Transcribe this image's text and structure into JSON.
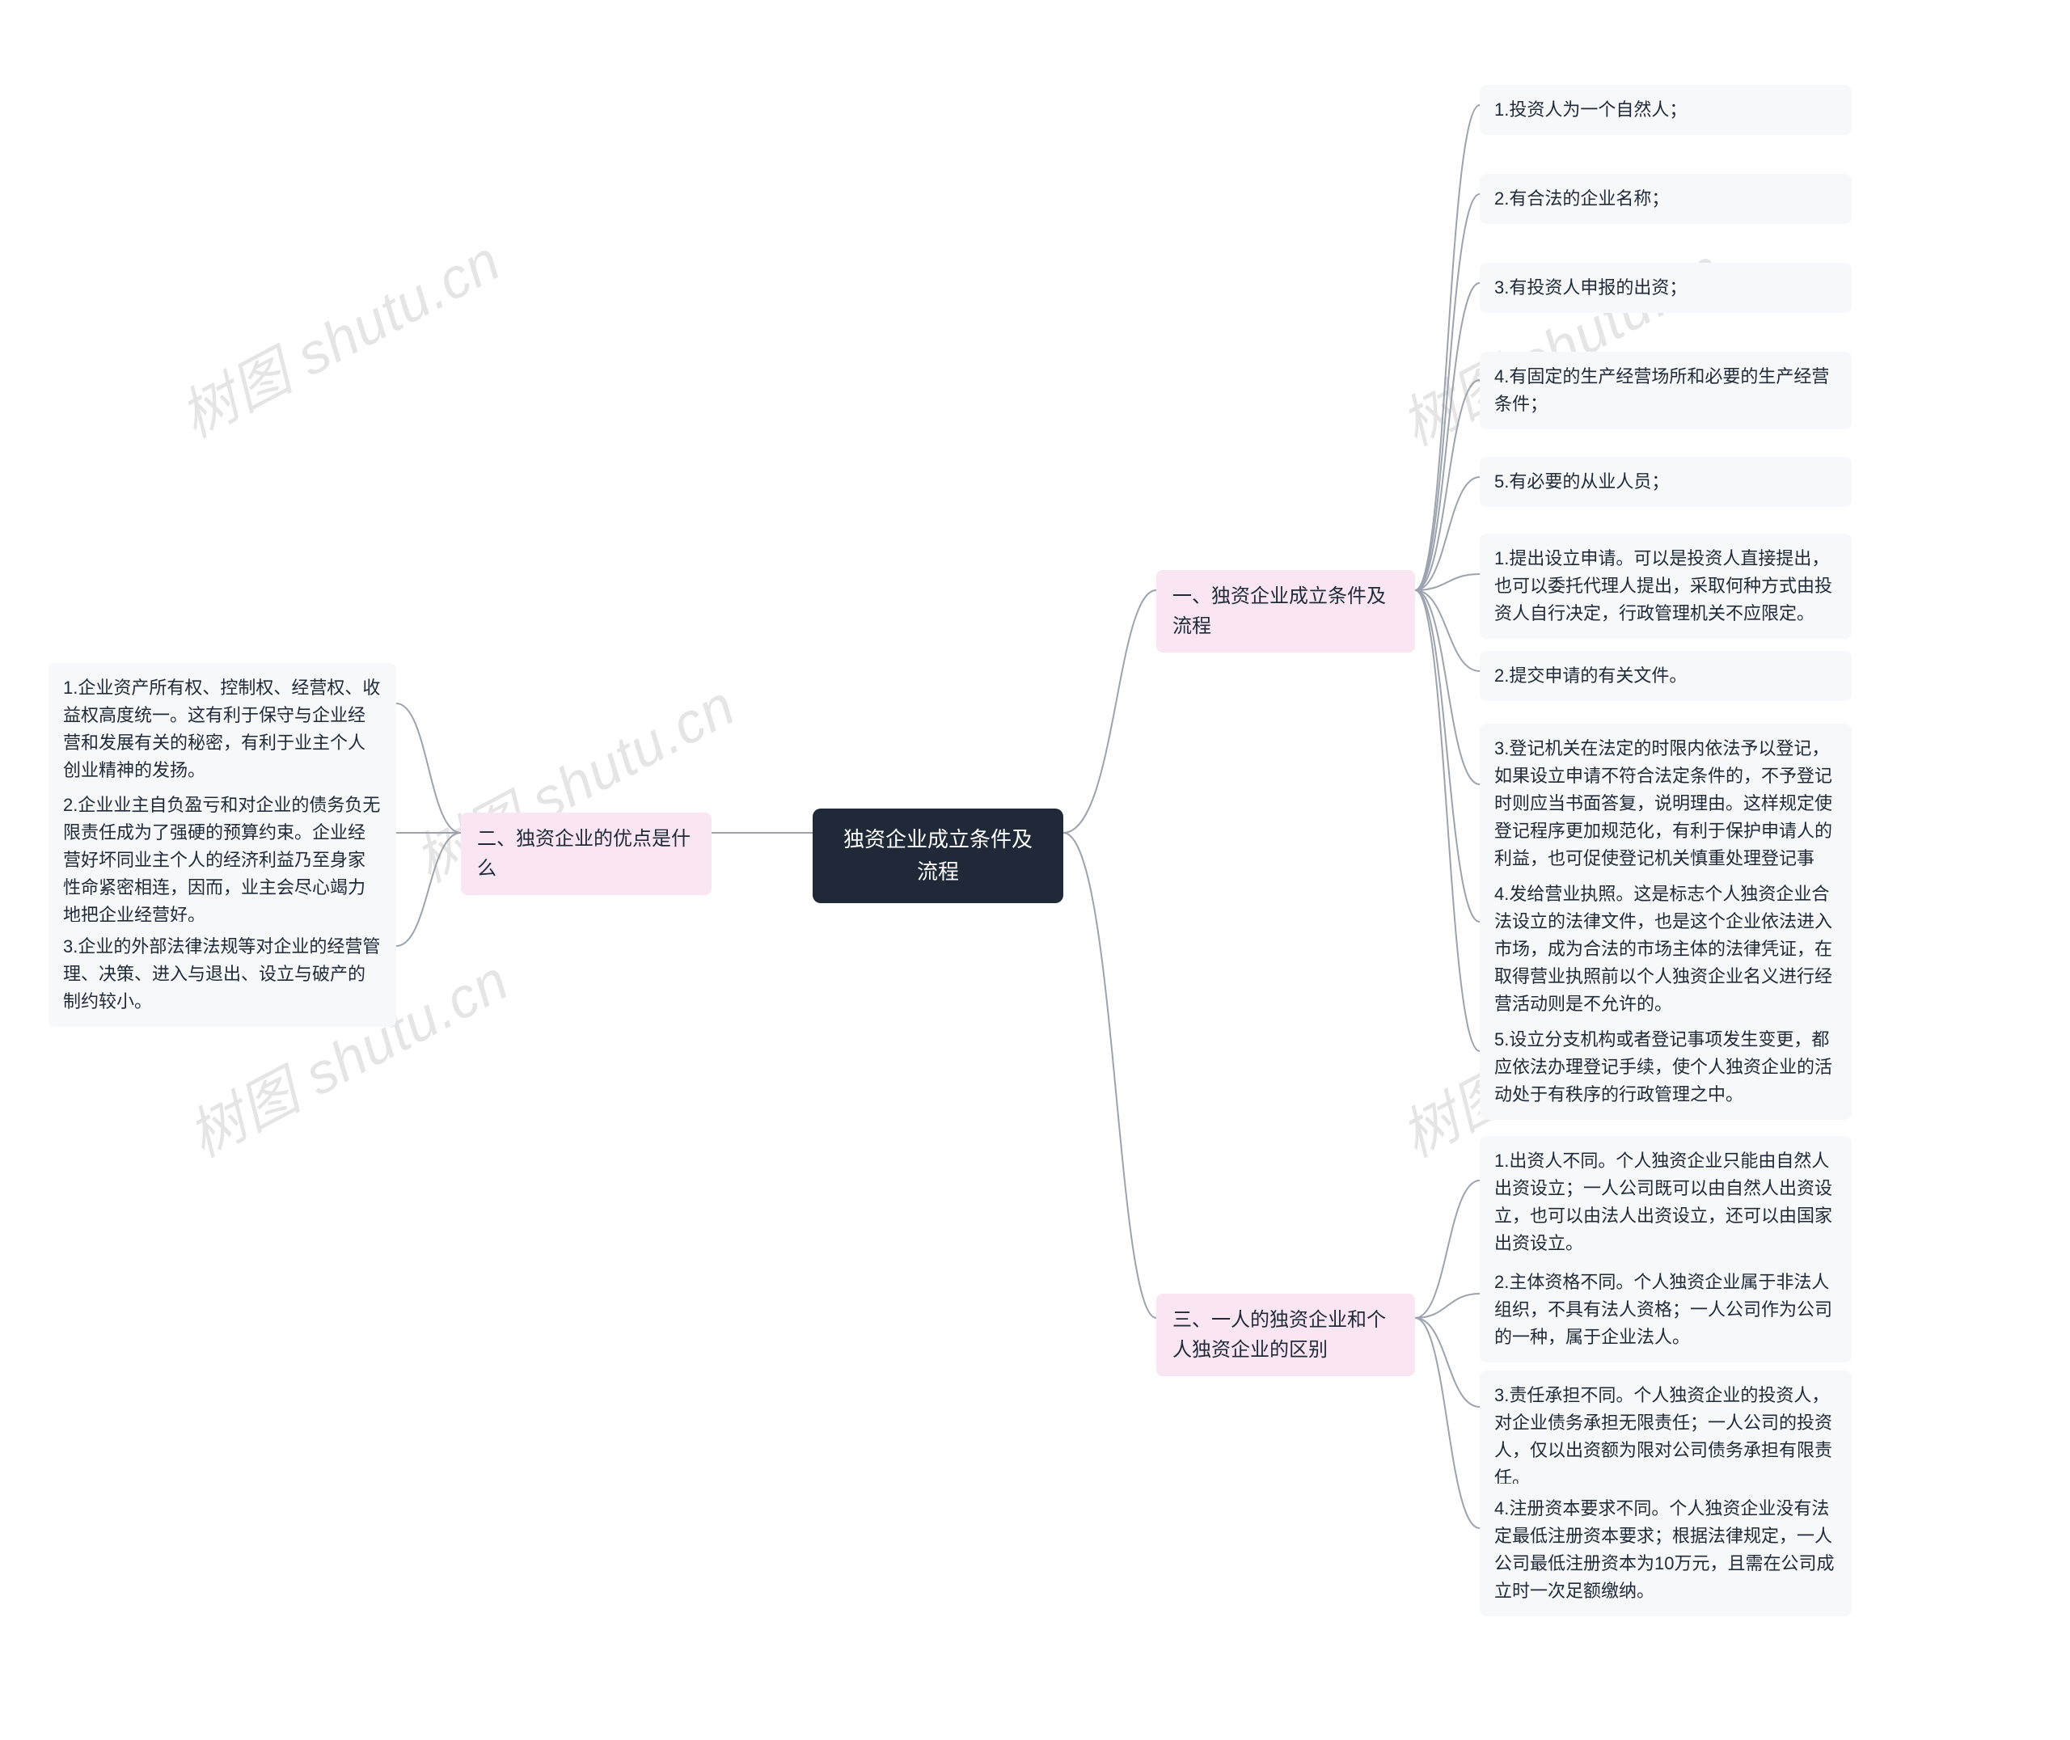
{
  "root": {
    "title": "独资企业成立条件及流程"
  },
  "branches": {
    "b1": {
      "label": "一、独资企业成立条件及流程"
    },
    "b2": {
      "label": "二、独资企业的优点是什么"
    },
    "b3": {
      "label": "三、一人的独资企业和个人独资企业的区别"
    }
  },
  "leaves": {
    "b1_1": "1.投资人为一个自然人；",
    "b1_2": "2.有合法的企业名称；",
    "b1_3": "3.有投资人申报的出资；",
    "b1_4": "4.有固定的生产经营场所和必要的生产经营条件；",
    "b1_5": "5.有必要的从业人员；",
    "b1_6": "1.提出设立申请。可以是投资人直接提出，也可以委托代理人提出，采取何种方式由投资人自行决定，行政管理机关不应限定。",
    "b1_7": "2.提交申请的有关文件。",
    "b1_8": "3.登记机关在法定的时限内依法予以登记，如果设立申请不符合法定条件的，不予登记时则应当书面答复，说明理由。这样规定使登记程序更加规范化，有利于保护申请人的利益，也可促使登记机关慎重处理登记事宜。",
    "b1_9": "4.发给营业执照。这是标志个人独资企业合法设立的法律文件，也是这个企业依法进入市场，成为合法的市场主体的法律凭证，在取得营业执照前以个人独资企业名义进行经营活动则是不允许的。",
    "b1_10": "5.设立分支机构或者登记事项发生变更，都应依法办理登记手续，使个人独资企业的活动处于有秩序的行政管理之中。",
    "b2_1": "1.企业资产所有权、控制权、经营权、收益权高度统一。这有利于保守与企业经营和发展有关的秘密，有利于业主个人创业精神的发扬。",
    "b2_2": "2.企业业主自负盈亏和对企业的债务负无限责任成为了强硬的预算约束。企业经营好坏同业主个人的经济利益乃至身家性命紧密相连，因而，业主会尽心竭力地把企业经营好。",
    "b2_3": "3.企业的外部法律法规等对企业的经营管理、决策、进入与退出、设立与破产的制约较小。",
    "b3_1": "1.出资人不同。个人独资企业只能由自然人出资设立；一人公司既可以由自然人出资设立，也可以由法人出资设立，还可以由国家出资设立。",
    "b3_2": "2.主体资格不同。个人独资企业属于非法人组织，不具有法人资格；一人公司作为公司的一种，属于企业法人。",
    "b3_3": "3.责任承担不同。个人独资企业的投资人，对企业债务承担无限责任；一人公司的投资人，仅以出资额为限对公司债务承担有限责任。",
    "b3_4": "4.注册资本要求不同。个人独资企业没有法定最低注册资本要求；根据法律规定，一人公司最低注册资本为10万元，且需在公司成立时一次足额缴纳。"
  },
  "watermark": "树图 shutu.cn",
  "chart_data": {
    "type": "mindmap",
    "root": "独资企业成立条件及流程",
    "children": [
      {
        "label": "一、独资企业成立条件及流程",
        "side": "right",
        "children": [
          "1.投资人为一个自然人；",
          "2.有合法的企业名称；",
          "3.有投资人申报的出资；",
          "4.有固定的生产经营场所和必要的生产经营条件；",
          "5.有必要的从业人员；",
          "1.提出设立申请。可以是投资人直接提出，也可以委托代理人提出，采取何种方式由投资人自行决定，行政管理机关不应限定。",
          "2.提交申请的有关文件。",
          "3.登记机关在法定的时限内依法予以登记，如果设立申请不符合法定条件的，不予登记时则应当书面答复，说明理由。这样规定使登记程序更加规范化，有利于保护申请人的利益，也可促使登记机关慎重处理登记事宜。",
          "4.发给营业执照。这是标志个人独资企业合法设立的法律文件，也是这个企业依法进入市场，成为合法的市场主体的法律凭证，在取得营业执照前以个人独资企业名义进行经营活动则是不允许的。",
          "5.设立分支机构或者登记事项发生变更，都应依法办理登记手续，使个人独资企业的活动处于有秩序的行政管理之中。"
        ]
      },
      {
        "label": "二、独资企业的优点是什么",
        "side": "left",
        "children": [
          "1.企业资产所有权、控制权、经营权、收益权高度统一。这有利于保守与企业经营和发展有关的秘密，有利于业主个人创业精神的发扬。",
          "2.企业业主自负盈亏和对企业的债务负无限责任成为了强硬的预算约束。企业经营好坏同业主个人的经济利益乃至身家性命紧密相连，因而，业主会尽心竭力地把企业经营好。",
          "3.企业的外部法律法规等对企业的经营管理、决策、进入与退出、设立与破产的制约较小。"
        ]
      },
      {
        "label": "三、一人的独资企业和个人独资企业的区别",
        "side": "right",
        "children": [
          "1.出资人不同。个人独资企业只能由自然人出资设立；一人公司既可以由自然人出资设立，也可以由法人出资设立，还可以由国家出资设立。",
          "2.主体资格不同。个人独资企业属于非法人组织，不具有法人资格；一人公司作为公司的一种，属于企业法人。",
          "3.责任承担不同。个人独资企业的投资人，对企业债务承担无限责任；一人公司的投资人，仅以出资额为限对公司债务承担有限责任。",
          "4.注册资本要求不同。个人独资企业没有法定最低注册资本要求；根据法律规定，一人公司最低注册资本为10万元，且需在公司成立时一次足额缴纳。"
        ]
      }
    ]
  }
}
